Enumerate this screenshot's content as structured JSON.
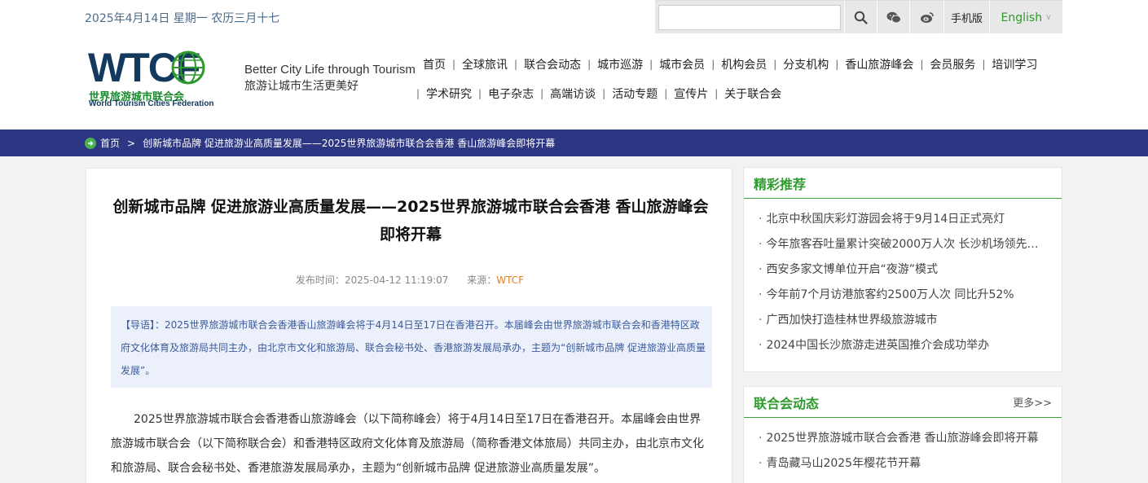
{
  "header": {
    "date_text": "2025年4月14日  星期一  农历三月十七",
    "search": {
      "value": "",
      "placeholder": ""
    },
    "mobile_label": "手机版",
    "language_label": "English",
    "logo_letters": "WTCF",
    "logo_cn": "世界旅游城市联合会",
    "logo_en": "World Tourism Cities Federation",
    "slogan_en": "Better City Life through Tourism",
    "slogan_cn": "旅游让城市生活更美好"
  },
  "nav": {
    "row1": [
      "首页",
      "全球旅讯",
      "联合会动态",
      "城市巡游",
      "城市会员",
      "机构会员",
      "分支机构",
      "香山旅游峰会",
      "会员服务",
      "培训学习"
    ],
    "row2": [
      "学术研究",
      "电子杂志",
      "高端访谈",
      "活动专题",
      "宣传片",
      "关于联合会"
    ]
  },
  "breadcrumb": {
    "home": "首页",
    "sep": ">",
    "current": "创新城市品牌 促进旅游业高质量发展——2025世界旅游城市联合会香港 香山旅游峰会即将开幕"
  },
  "article": {
    "title": "创新城市品牌 促进旅游业高质量发展——2025世界旅游城市联合会香港 香山旅游峰会即将开幕",
    "publish_label": "发布时间：",
    "publish_time": "2025-04-12 11:19:07",
    "source_label": "来源：",
    "source": "WTCF",
    "lead_label": "【导语】：",
    "lead_text": "2025世界旅游城市联合会香港香山旅游峰会将于4月14日至17日在香港召开。本届峰会由世界旅游城市联合会和香港特区政府文化体育及旅游局共同主办，由北京市文化和旅游局、联合会秘书处、香港旅游发展局承办，主题为“创新城市品牌 促进旅游业高质量发展”。",
    "body": "2025世界旅游城市联合会香港香山旅游峰会（以下简称峰会）将于4月14日至17日在香港召开。本届峰会由世界旅游城市联合会（以下简称联合会）和香港特区政府文化体育及旅游局（简称香港文体旅局）共同主办，由北京市文化和旅游局、联合会秘书处、香港旅游发展局承办，主题为“创新城市品牌 促进旅游业高质量发展”。"
  },
  "sidebar": {
    "featured": {
      "title": "精彩推荐",
      "items": [
        "北京中秋国庆彩灯游园会将于9月14日正式亮灯",
        "今年旅客吞吐量累计突破2000万人次 长沙机场领先…",
        "西安多家文博单位开启“夜游”模式",
        "今年前7个月访港旅客约2500万人次 同比升52%",
        "广西加快打造桂林世界级旅游城市",
        "2024中国长沙旅游走进英国推介会成功举办"
      ]
    },
    "news": {
      "title": "联合会动态",
      "more": "更多>>",
      "items": [
        "2025世界旅游城市联合会香港 香山旅游峰会即将开幕",
        "青岛藏马山2025年樱花节开幕"
      ]
    }
  },
  "colors": {
    "nav_bar": "#2d3682",
    "accent_green": "#2e9a2e",
    "source_orange": "#ee7d1d",
    "lead_bg": "#ebf0fb"
  }
}
